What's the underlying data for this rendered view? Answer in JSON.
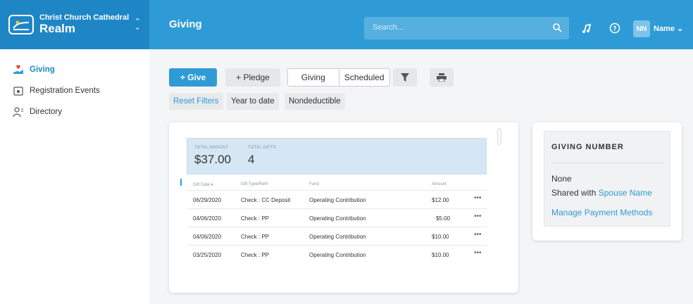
{
  "brand": {
    "org": "Christ Church Cathedral",
    "app": "Realm"
  },
  "header": {
    "title": "Giving",
    "search_placeholder": "Search...",
    "avatar_initials": "NN",
    "user_name": "Name"
  },
  "sidebar": {
    "items": [
      {
        "label": "Giving",
        "icon": "giving-icon",
        "active": true
      },
      {
        "label": "Registration Events",
        "icon": "registration-icon",
        "active": false
      },
      {
        "label": "Directory",
        "icon": "directory-icon",
        "active": false
      }
    ]
  },
  "toolbar": {
    "give": "+ Give",
    "pledge": "+ Pledge",
    "tab_giving": "Giving",
    "tab_scheduled": "Scheduled"
  },
  "filters": {
    "reset": "Reset Filters",
    "year": "Year to date",
    "nondeductible": "Nondeductible"
  },
  "summary": {
    "total_amount_label": "TOTAL AMOUNT",
    "total_amount": "$37.00",
    "total_gifts_label": "TOTAL GIFTS",
    "total_gifts": "4"
  },
  "table": {
    "headers": {
      "date": "Gift Date ▾",
      "type": "Gift Type/Ref#",
      "fund": "Fund",
      "amount": "Amount"
    },
    "rows": [
      {
        "date": "06/29/2020",
        "type": "Check : CC Deposit",
        "fund": "Operating Contribution",
        "amount": "$12.00",
        "menu": "•••"
      },
      {
        "date": "04/06/2020",
        "type": "Check : PP",
        "fund": "Operating Contribution",
        "amount": "$5.00",
        "menu": "•••"
      },
      {
        "date": "04/06/2020",
        "type": "Check : PP",
        "fund": "Operating Contribution",
        "amount": "$10.00",
        "menu": "•••"
      },
      {
        "date": "03/25/2020",
        "type": "Check : PP",
        "fund": "Operating Contribution",
        "amount": "$10.00",
        "menu": "•••"
      }
    ]
  },
  "giving_number": {
    "title": "GIVING NUMBER",
    "value": "None",
    "shared_prefix": "Shared with",
    "shared_name": "Spouse Name",
    "manage_link": "Manage Payment Methods"
  },
  "colors": {
    "primary": "#2f9bd6",
    "brand_dark": "#1f86c6"
  }
}
